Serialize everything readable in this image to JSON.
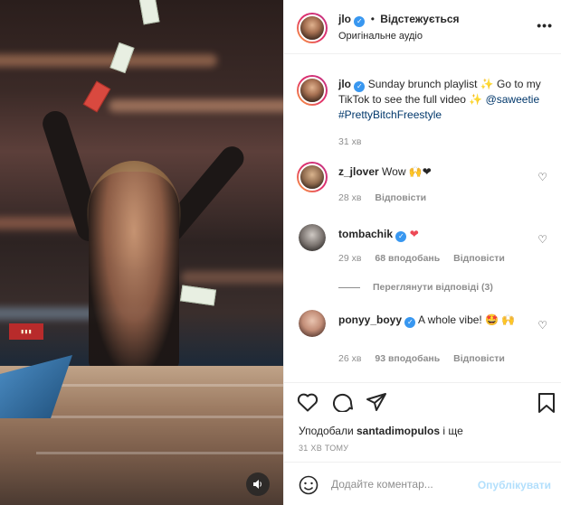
{
  "post": {
    "media": {
      "audio_icon": "speaker-icon"
    },
    "header": {
      "username": "jlo",
      "separator": "•",
      "follow_status": "Відстежується",
      "audio": "Оригінальне аудіо",
      "more_icon": "•••"
    },
    "caption": {
      "username": "jlo",
      "text": "Sunday brunch playlist ✨ Go to my TikTok to see the full video ✨",
      "mention": "@saweetie",
      "hashtag": "#PrettyBitchFreestyle",
      "time": "31 хв"
    },
    "comments": [
      {
        "username": "z_jlover",
        "text": "Wow 🙌❤",
        "time": "28 хв",
        "reply": "Відповісти"
      },
      {
        "username": "tombachik",
        "text": "❤",
        "time": "29 хв",
        "likes": "68 вподобань",
        "reply": "Відповісти",
        "view_replies": "Переглянути відповіді (3)"
      },
      {
        "username": "ponyy_boyy",
        "text": "A whole vibe! 🤩 🙌",
        "time": "26 хв",
        "likes": "93 вподобань",
        "reply": "Відповісти"
      }
    ],
    "actions": {
      "liked_by_prefix": "Уподобали",
      "liked_by_user": "santadimopulos",
      "liked_by_suffix": "і ще",
      "timestamp": "31 ХВ ТОМУ"
    },
    "compose": {
      "placeholder": "Додайте коментар...",
      "publish": "Опублікувати"
    }
  }
}
